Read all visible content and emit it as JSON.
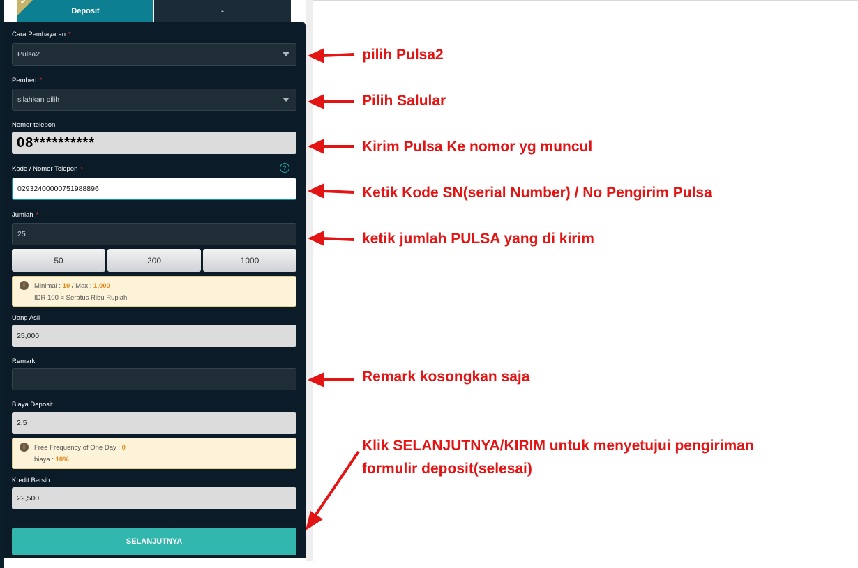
{
  "tabs": {
    "deposit": "Deposit",
    "other": "-"
  },
  "form": {
    "payment_method": {
      "label": "Cara Pembayaran",
      "required": "*",
      "value": "Pulsa2"
    },
    "provider": {
      "label": "Pemberi",
      "required": "*",
      "value": "silahkan pilih"
    },
    "phone_number": {
      "label": "Nomor telepon",
      "value": "08**********"
    },
    "code_phone": {
      "label": "Kode / Nomor Telepon",
      "required": "*",
      "value": "02932400000751988896",
      "help": "?"
    },
    "amount": {
      "label": "Jumlah",
      "required": "*",
      "value": "25"
    },
    "quick_amounts": [
      "50",
      "200",
      "1000"
    ],
    "limits_note": {
      "minimal_label": "Minimal : ",
      "minimal": "10",
      "sep": " / Max : ",
      "max": "1,000",
      "line2": "IDR 100 = Seratus Ribu Rupiah"
    },
    "real_money": {
      "label": "Uang Asli",
      "value": "25,000"
    },
    "remark": {
      "label": "Remark",
      "value": ""
    },
    "deposit_fee": {
      "label": "Biaya Deposit",
      "value": "2.5"
    },
    "fee_note": {
      "freq_label": "Free Frequency of One Day : ",
      "freq": "0",
      "fee_label": "biaya : ",
      "fee": "10%"
    },
    "net_credit": {
      "label": "Kredit Bersih",
      "value": "22,500"
    },
    "submit_label": "SELANJUTNYA"
  },
  "annotations": {
    "a1": "pilih Pulsa2",
    "a2": "Pilih Salular",
    "a3": "Kirim Pulsa Ke nomor yg muncul",
    "a4": "Ketik Kode SN(serial Number) / No Pengirim Pulsa",
    "a5": "ketik jumlah PULSA yang di kirim",
    "a6": "Remark kosongkan saja",
    "a7_line1": "Klik SELANJUTNYA/KIRIM untuk menyetujui pengiriman",
    "a7_line2": "formulir deposit(selesai)"
  },
  "colors": {
    "panel": "#0c1b28",
    "accent": "#31b7ae",
    "tab_active": "#0d7f92",
    "annotation": "#e31414"
  }
}
